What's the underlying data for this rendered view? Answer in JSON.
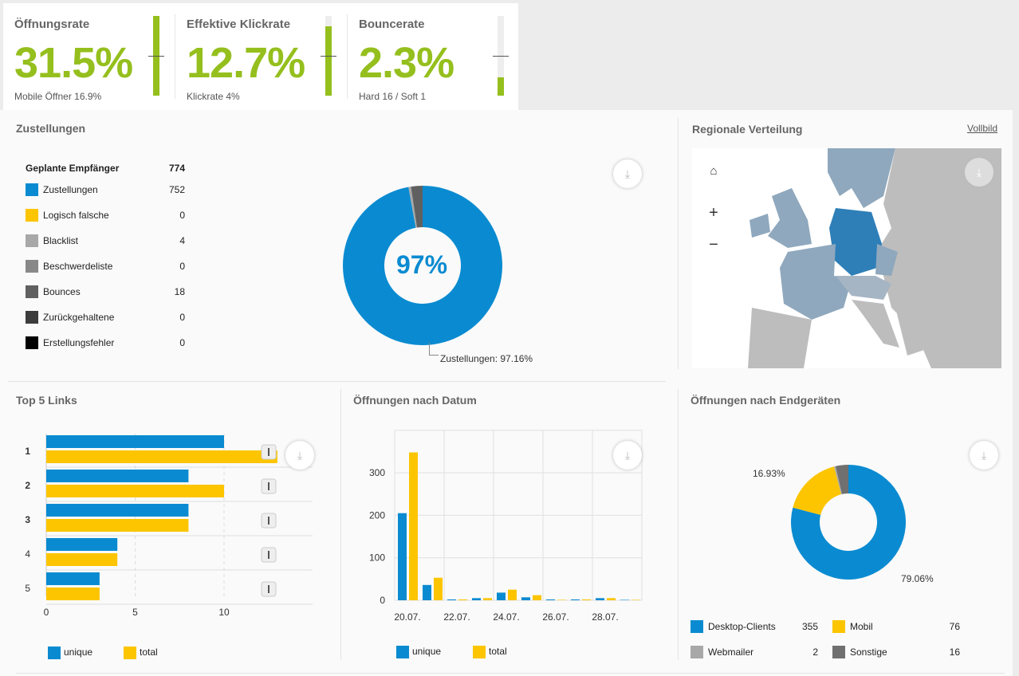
{
  "colors": {
    "green": "#95bf1d",
    "blue": "#0a8bd1",
    "yellow": "#fcc500"
  },
  "kpis": [
    {
      "title": "Öffnungsrate",
      "value": "31.5%",
      "sub": "Mobile Öffner 16.9%",
      "fill": 1.0
    },
    {
      "title": "Effektive Klickrate",
      "value": "12.7%",
      "sub": "Klickrate 4%",
      "fill": 0.87
    },
    {
      "title": "Bouncerate",
      "value": "2.3%",
      "sub": "Hard 16 / Soft 1",
      "fill": 0.23
    }
  ],
  "zustellungen": {
    "title": "Zustellungen",
    "header": {
      "label": "Geplante Empfänger",
      "value": "774"
    },
    "rows": [
      {
        "label": "Zustellungen",
        "value": "752",
        "color": "#0a8bd1"
      },
      {
        "label": "Logisch falsche",
        "value": "0",
        "color": "#fcc500"
      },
      {
        "label": "Blacklist",
        "value": "4",
        "color": "#a8a8a8"
      },
      {
        "label": "Beschwerdeliste",
        "value": "0",
        "color": "#888888"
      },
      {
        "label": "Bounces",
        "value": "18",
        "color": "#606060"
      },
      {
        "label": "Zurückgehaltene",
        "value": "0",
        "color": "#3c3c3c"
      },
      {
        "label": "Erstellungsfehler",
        "value": "0",
        "color": "#000000"
      }
    ],
    "center_label": "97%",
    "tooltip": "Zustellungen: 97.16%"
  },
  "regional": {
    "title": "Regionale Verteilung",
    "fullscreen_link": "Vollbild"
  },
  "top_links": {
    "title": "Top 5 Links"
  },
  "opens_by_date": {
    "title": "Öffnungen nach Datum"
  },
  "devices": {
    "title": "Öffnungen nach Endgeräten",
    "label_mobile": "16.93%",
    "label_desktop": "79.06%",
    "legend": [
      {
        "label": "Desktop-Clients",
        "value": "355",
        "color": "#0a8bd1"
      },
      {
        "label": "Mobil",
        "value": "76",
        "color": "#fcc500"
      },
      {
        "label": "Webmailer",
        "value": "2",
        "color": "#a8a8a8"
      },
      {
        "label": "Sonstige",
        "value": "16",
        "color": "#707070"
      }
    ]
  },
  "chart_data": [
    {
      "type": "pie",
      "title": "Zustellungen",
      "categories": [
        "Zustellungen",
        "Blacklist",
        "Bounces"
      ],
      "values": [
        752,
        4,
        18
      ],
      "donut": true
    },
    {
      "type": "bar",
      "orientation": "horizontal",
      "title": "Top 5 Links",
      "categories": [
        "1",
        "2",
        "3",
        "4",
        "5"
      ],
      "series": [
        {
          "name": "unique",
          "values": [
            10,
            8,
            8,
            4,
            3
          ]
        },
        {
          "name": "total",
          "values": [
            13,
            10,
            8,
            4,
            3
          ]
        }
      ],
      "xticks": [
        "0",
        "5",
        "10"
      ],
      "xlim": [
        0,
        15
      ],
      "grid": true,
      "legend": "bottom-left"
    },
    {
      "type": "bar",
      "title": "Öffnungen nach Datum",
      "categories": [
        "20.07.",
        "21.07.",
        "22.07.",
        "23.07.",
        "24.07.",
        "25.07.",
        "26.07.",
        "27.07.",
        "28.07.",
        "29.07."
      ],
      "xticks": [
        "20.07.",
        "22.07.",
        "24.07.",
        "26.07.",
        "28.07."
      ],
      "series": [
        {
          "name": "unique",
          "values": [
            205,
            36,
            2,
            5,
            18,
            7,
            2,
            2,
            5,
            1
          ]
        },
        {
          "name": "total",
          "values": [
            348,
            53,
            2,
            5,
            25,
            12,
            1,
            2,
            5,
            1
          ]
        }
      ],
      "yticks": [
        "0",
        "100",
        "200",
        "300"
      ],
      "ylim": [
        0,
        400
      ],
      "grid": true,
      "legend": "bottom-left"
    },
    {
      "type": "pie",
      "title": "Öffnungen nach Endgeräten",
      "categories": [
        "Desktop-Clients",
        "Mobil",
        "Webmailer",
        "Sonstige"
      ],
      "values": [
        355,
        76,
        2,
        16
      ],
      "donut": true
    }
  ],
  "legend": {
    "unique": "unique",
    "total": "total"
  }
}
